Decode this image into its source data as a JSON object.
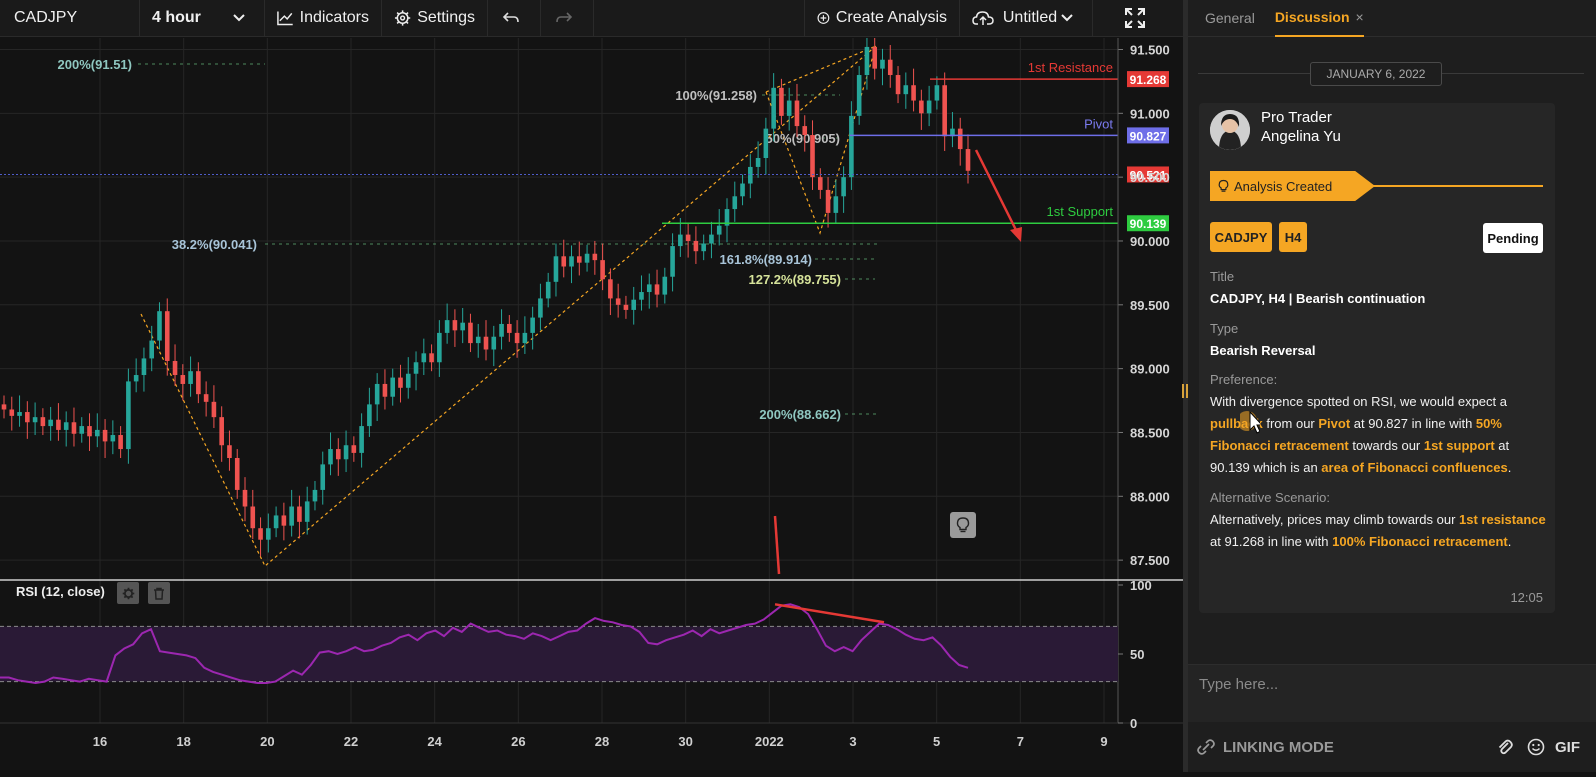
{
  "toolbar": {
    "symbol": "CADJPY",
    "timeframe": "4 hour",
    "indicators_label": "Indicators",
    "settings_label": "Settings",
    "create_label": "Create Analysis",
    "doc_label": "Untitled"
  },
  "chart_data": {
    "type": "candlestick",
    "price_axis_ticks": [
      "91.500",
      "91.000",
      "90.500",
      "90.000",
      "89.500",
      "89.000",
      "88.500",
      "88.000",
      "87.500"
    ],
    "price_range": [
      87.36,
      91.59
    ],
    "x_tick_labels": [
      "16",
      "18",
      "20",
      "22",
      "24",
      "26",
      "28",
      "30",
      "2022",
      "3",
      "5",
      "7",
      "9"
    ],
    "fib_labels": {
      "f200_top": "200%(91.51)",
      "f100": "100%(91.258)",
      "f50": "50%(90.905)",
      "f382": "38.2%(90.041)",
      "f1618": "161.8%(89.914)",
      "f1272": "127.2%(89.755)",
      "f200_bot": "200%(88.662)"
    },
    "levels": {
      "resistance": {
        "name": "1st Resistance",
        "value": "91.268",
        "color": "#e53935"
      },
      "pivot": {
        "name": "Pivot",
        "value": "90.827",
        "color": "#6e6ee8"
      },
      "current": {
        "value": "90.521",
        "color": "#e53935"
      },
      "support": {
        "name": "1st Support",
        "value": "90.139",
        "color": "#2ecc40"
      }
    },
    "candle_closes": [
      88.68,
      88.63,
      88.66,
      88.58,
      88.62,
      88.55,
      88.6,
      88.52,
      88.58,
      88.49,
      88.55,
      88.47,
      88.52,
      88.43,
      88.48,
      88.37,
      88.9,
      88.95,
      89.08,
      89.22,
      89.45,
      89.06,
      88.95,
      88.88,
      88.98,
      88.8,
      88.74,
      88.62,
      88.4,
      88.3,
      88.05,
      87.92,
      87.75,
      87.66,
      87.75,
      87.85,
      87.77,
      87.92,
      87.8,
      87.96,
      88.05,
      88.25,
      88.37,
      88.29,
      88.4,
      88.34,
      88.55,
      88.72,
      88.88,
      88.78,
      88.93,
      88.85,
      88.96,
      89.05,
      89.12,
      89.05,
      89.28,
      89.38,
      89.3,
      89.36,
      89.2,
      89.25,
      89.15,
      89.25,
      89.35,
      89.28,
      89.2,
      89.28,
      89.4,
      89.55,
      89.68,
      89.88,
      89.8,
      89.88,
      89.83,
      89.9,
      89.85,
      89.7,
      89.55,
      89.5,
      89.46,
      89.54,
      89.6,
      89.66,
      89.58,
      89.72,
      89.96,
      90.05,
      90.0,
      89.92,
      89.98,
      90.05,
      90.12,
      90.25,
      90.35,
      90.45,
      90.58,
      90.65,
      90.88,
      91.2,
      90.98,
      91.1,
      90.9,
      90.83,
      90.5,
      90.4,
      90.22,
      90.35,
      90.5,
      90.98,
      91.3,
      91.52,
      91.35,
      91.42,
      91.3,
      91.15,
      91.22,
      91.1,
      91.0,
      91.1,
      91.22,
      90.82,
      90.88,
      90.72,
      90.55
    ],
    "rsi": {
      "label": "RSI (12, close)",
      "ticks": [
        "100",
        "50",
        "0"
      ],
      "ylim": [
        0,
        100
      ],
      "overbought": 70,
      "oversold": 30,
      "color": "#9c27b0",
      "values": [
        33,
        33,
        31,
        30,
        29,
        30,
        33,
        32,
        31,
        30,
        32,
        31,
        30,
        49,
        54,
        57,
        65,
        68,
        52,
        51,
        50,
        49,
        47,
        40,
        37,
        35,
        33,
        31,
        30,
        29,
        29,
        30,
        34,
        38,
        35,
        42,
        51,
        52,
        50,
        52,
        55,
        52,
        53,
        56,
        58,
        62,
        64,
        60,
        65,
        67,
        63,
        69,
        66,
        72,
        69,
        66,
        67,
        64,
        63,
        61,
        65,
        63,
        60,
        63,
        66,
        67,
        72,
        76,
        74,
        73,
        71,
        70,
        66,
        58,
        57,
        60,
        62,
        64,
        67,
        63,
        68,
        65,
        67,
        69,
        71,
        72,
        75,
        80,
        85,
        86,
        84,
        79,
        68,
        56,
        52,
        55,
        52,
        60,
        66,
        72,
        71,
        68,
        64,
        61,
        60,
        62,
        56,
        48,
        42,
        40
      ]
    }
  },
  "panel": {
    "tab_general": "General",
    "tab_discussion": "Discussion",
    "tab_close": "×",
    "date": "JANUARY 6, 2022",
    "user_line1": "Pro Trader",
    "user_line2": "Angelina Yu",
    "status": "Analysis Created",
    "tags": [
      "CADJPY",
      "H4"
    ],
    "pending": "Pending",
    "title_label": "Title",
    "title_value": "CADJPY, H4 | Bearish continuation",
    "type_label": "Type",
    "type_value": "Bearish Reversal",
    "pref_label": "Preference:",
    "pref_parts": [
      "With divergence spotted on RSI, we would expect a ",
      "pullback",
      " from our ",
      "Pivot",
      " at 90.827 in line with ",
      "50% Fibonacci retracement",
      " towards our ",
      "1st support",
      " at 90.139 which is an ",
      "area of Fibonacci confluences",
      "."
    ],
    "alt_label": "Alternative Scenario:",
    "alt_parts": [
      "Alternatively, prices may climb towards our ",
      "1st resistance",
      " at 91.268 in line with ",
      "100% Fibonacci retracement",
      "."
    ],
    "time": "12:05",
    "input_placeholder": "Type here...",
    "linking_label": "LINKING MODE",
    "gif_label": "GIF"
  }
}
